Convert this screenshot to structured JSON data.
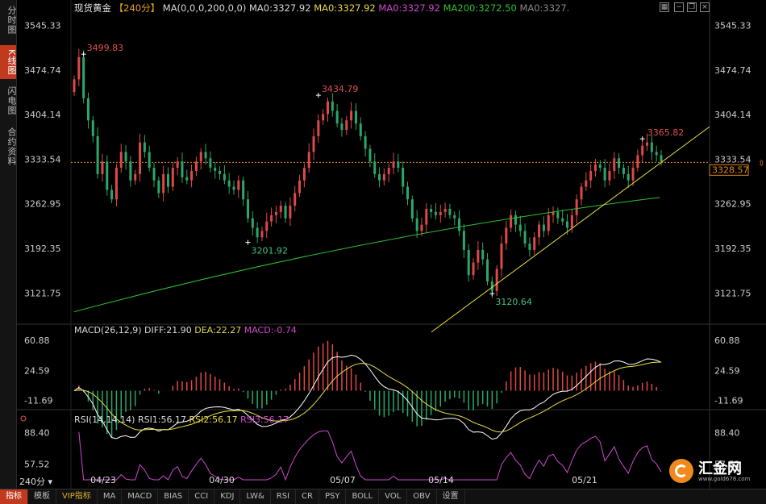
{
  "sidebar": {
    "tabs": [
      {
        "label": "分时图",
        "active": false
      },
      {
        "label": "K线图",
        "active": true
      },
      {
        "label": "闪电图",
        "active": false
      },
      {
        "label": "合约资料",
        "active": false
      }
    ]
  },
  "header": {
    "symbol": "现货黄金",
    "period": "【240分】",
    "ma_params": "MA(0,0,0,200,0,0)",
    "ma_values": [
      {
        "label": "MA0:3327.92",
        "color": "#d9d9d9"
      },
      {
        "label": "MA0:3327.92",
        "color": "#e8d84a"
      },
      {
        "label": "MA0:3327.92",
        "color": "#d048d0"
      },
      {
        "label": "MA200:3272.50",
        "color": "#30c030"
      },
      {
        "label": "MA0:3327.",
        "color": "#888888"
      }
    ]
  },
  "macd_header": {
    "name": "MACD(26,12,9)",
    "diff": "DIFF:21.90",
    "dea": "DEA:22.27",
    "macd": "MACD:-0.74"
  },
  "rsi_header": {
    "name": "RSI(14,14,14)",
    "rsi1": "RSI1:56.17",
    "rsi2": "RSI2:56.17",
    "rsi3": "RSI3:56.17"
  },
  "price_axis": [
    "3545.33",
    "3474.74",
    "3404.14",
    "3333.54",
    "3262.95",
    "3192.35",
    "3121.75"
  ],
  "macd_axis": [
    "60.88",
    "24.59",
    "-11.69"
  ],
  "rsi_axis": [
    "88.40",
    "57.52"
  ],
  "x_axis": [
    "04/23",
    "04/30",
    "05/07",
    "05/14",
    "05/21"
  ],
  "current_price": "3328.57",
  "annotations": [
    {
      "label": "3499.83",
      "kind": "high"
    },
    {
      "label": "3434.79",
      "kind": "high"
    },
    {
      "label": "3365.82",
      "kind": "high"
    },
    {
      "label": "3201.92",
      "kind": "low"
    },
    {
      "label": "3120.64",
      "kind": "low"
    }
  ],
  "colors": {
    "up": "#e04848",
    "down": "#2aa86a",
    "ma200": "#30c030",
    "trend": "#e8e040",
    "accent": "#c23a1e"
  },
  "bottom_bar": {
    "tabs": [
      "指标",
      "模板",
      "VIP指标",
      "MA",
      "MACD",
      "BIAS",
      "CCI",
      "KDJ",
      "LW&",
      "RSI",
      "CR",
      "PSY",
      "BOLL",
      "VOL",
      "OBV",
      "设置"
    ]
  },
  "period_select": "240分",
  "watermark": {
    "name": "汇金网",
    "url": "www.gold678.com"
  },
  "chart_data": {
    "type": "candlestick",
    "title": "现货黄金",
    "period": "240分",
    "x_ticks": [
      "04/23",
      "04/30",
      "05/07",
      "05/14",
      "05/21"
    ],
    "price_range": [
      3075,
      3560
    ],
    "series": [
      {
        "name": "MA200",
        "values": [
          3092,
          3255,
          3273
        ]
      },
      {
        "name": "DIFF",
        "value": 21.9
      },
      {
        "name": "DEA",
        "value": 22.27
      },
      {
        "name": "MACD",
        "value": -0.74
      },
      {
        "name": "RSI1",
        "value": 56.17
      }
    ],
    "key_points": {
      "high": [
        3499.83,
        3434.79,
        3365.82
      ],
      "low": [
        3201.92,
        3120.64
      ],
      "last": 3328.57
    },
    "ohlc_path": [
      3460,
      3495,
      3430,
      3395,
      3370,
      3310,
      3330,
      3285,
      3270,
      3320,
      3345,
      3330,
      3300,
      3310,
      3360,
      3345,
      3320,
      3300,
      3280,
      3310,
      3290,
      3320,
      3330,
      3305,
      3300,
      3315,
      3330,
      3345,
      3335,
      3320,
      3315,
      3310,
      3300,
      3290,
      3285,
      3300,
      3270,
      3240,
      3225,
      3210,
      3220,
      3235,
      3245,
      3250,
      3260,
      3240,
      3260,
      3280,
      3300,
      3320,
      3345,
      3370,
      3395,
      3405,
      3425,
      3410,
      3390,
      3380,
      3395,
      3410,
      3390,
      3370,
      3350,
      3330,
      3310,
      3300,
      3310,
      3320,
      3330,
      3320,
      3290,
      3270,
      3240,
      3220,
      3230,
      3255,
      3250,
      3245,
      3250,
      3255,
      3245,
      3240,
      3220,
      3190,
      3150,
      3170,
      3190,
      3175,
      3140,
      3125,
      3160,
      3200,
      3225,
      3245,
      3230,
      3220,
      3200,
      3190,
      3210,
      3230,
      3220,
      3245,
      3250,
      3240,
      3235,
      3225,
      3245,
      3270,
      3290,
      3300,
      3315,
      3325,
      3320,
      3300,
      3315,
      3335,
      3320,
      3310,
      3300,
      3320,
      3340,
      3355,
      3360,
      3345,
      3340,
      3330
    ]
  }
}
